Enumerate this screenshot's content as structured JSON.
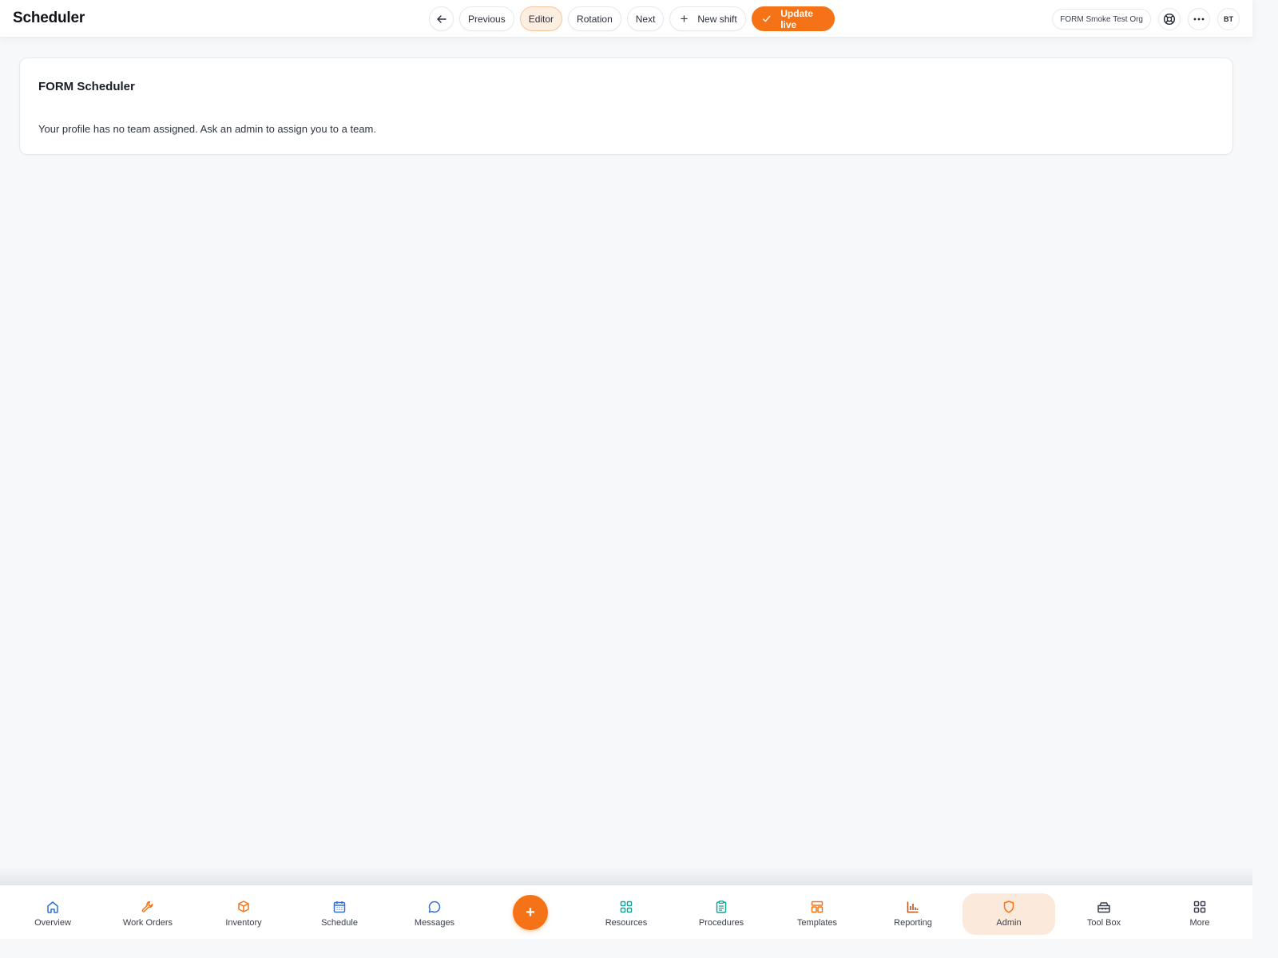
{
  "header": {
    "title": "Scheduler",
    "toolbar": {
      "previous": "Previous",
      "editor": "Editor",
      "rotation": "Rotation",
      "next": "Next",
      "new_shift": "New shift",
      "update_live": "Update live"
    },
    "org": "FORM Smoke Test Org",
    "avatar_initials": "BT"
  },
  "card": {
    "title": "FORM Scheduler",
    "message": "Your profile has no team assigned. Ask an admin to assign you to a team."
  },
  "bottom_nav": {
    "items": [
      {
        "label": "Overview",
        "icon": "home-icon"
      },
      {
        "label": "Work Orders",
        "icon": "wrench-icon"
      },
      {
        "label": "Inventory",
        "icon": "box-icon"
      },
      {
        "label": "Schedule",
        "icon": "calendar-icon"
      },
      {
        "label": "Messages",
        "icon": "chat-bubble-icon"
      },
      {
        "label": "Resources",
        "icon": "grid-icon"
      },
      {
        "label": "Procedures",
        "icon": "clipboard-icon"
      },
      {
        "label": "Templates",
        "icon": "template-icon"
      },
      {
        "label": "Reporting",
        "icon": "bar-chart-icon"
      },
      {
        "label": "Admin",
        "icon": "shield-icon",
        "active": true
      },
      {
        "label": "Tool Box",
        "icon": "toolbox-icon"
      },
      {
        "label": "More",
        "icon": "more-grid-icon"
      }
    ],
    "fab": "+"
  },
  "colors": {
    "accent": "#f57316",
    "active_bg": "#fbe9dc",
    "blue": "#2f6fd6",
    "teal": "#16a39a"
  }
}
